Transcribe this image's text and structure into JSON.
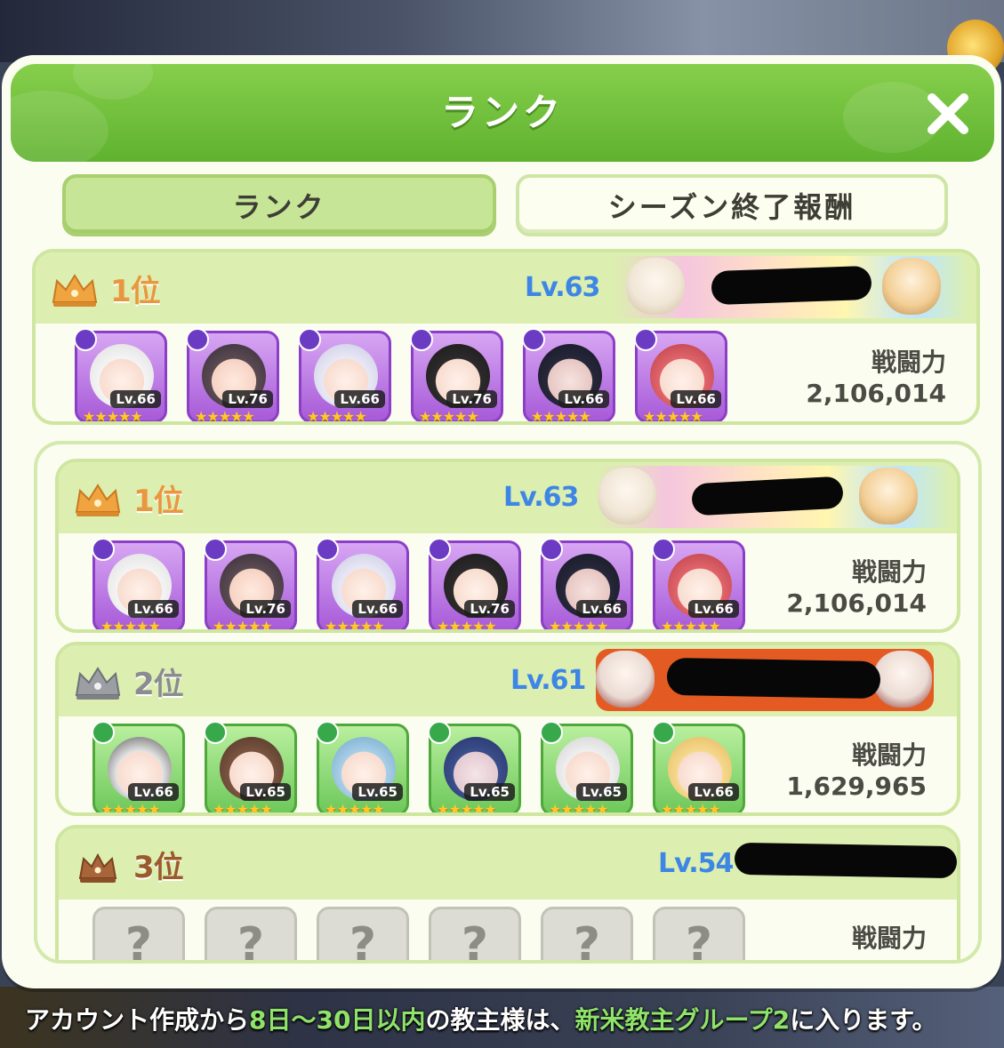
{
  "modal": {
    "title": "ランク",
    "close_icon": "close-icon"
  },
  "tabs": [
    {
      "label": "ランク",
      "active": true
    },
    {
      "label": "シーズン終了報酬",
      "active": false
    }
  ],
  "my_rank": {
    "rank": "1位",
    "level": "Lv.63",
    "power_label": "戦闘力",
    "power": "2,106,014",
    "units": [
      {
        "lv": "Lv.66",
        "stars": "★★★★★"
      },
      {
        "lv": "Lv.76",
        "stars": "★★★★★"
      },
      {
        "lv": "Lv.66",
        "stars": "★★★★★"
      },
      {
        "lv": "Lv.76",
        "stars": "★★★★★"
      },
      {
        "lv": "Lv.66",
        "stars": "★★★★★"
      },
      {
        "lv": "Lv.66",
        "stars": "★★★★★"
      }
    ]
  },
  "ranking": [
    {
      "rank": "1位",
      "level": "Lv.63",
      "power_label": "戦闘力",
      "power": "2,106,014",
      "units": [
        {
          "lv": "Lv.66",
          "stars": "★★★★★"
        },
        {
          "lv": "Lv.76",
          "stars": "★★★★★"
        },
        {
          "lv": "Lv.66",
          "stars": "★★★★★"
        },
        {
          "lv": "Lv.76",
          "stars": "★★★★★"
        },
        {
          "lv": "Lv.66",
          "stars": "★★★★★"
        },
        {
          "lv": "Lv.66",
          "stars": "★★★★★"
        }
      ]
    },
    {
      "rank": "2位",
      "level": "Lv.61",
      "power_label": "戦闘力",
      "power": "1,629,965",
      "units": [
        {
          "lv": "Lv.66",
          "stars": "★★★★★"
        },
        {
          "lv": "Lv.65",
          "stars": "★★★★★"
        },
        {
          "lv": "Lv.65",
          "stars": "★★★★★"
        },
        {
          "lv": "Lv.65",
          "stars": "★★★★★"
        },
        {
          "lv": "Lv.65",
          "stars": "★★★★★"
        },
        {
          "lv": "Lv.66",
          "stars": "★★★★★"
        }
      ]
    },
    {
      "rank": "3位",
      "level": "Lv.54",
      "power_label": "戦闘力",
      "units": [
        {
          "q": "?"
        },
        {
          "q": "?"
        },
        {
          "q": "?"
        },
        {
          "q": "?"
        },
        {
          "q": "?"
        },
        {
          "q": "?"
        }
      ]
    }
  ],
  "footer": {
    "part1": "アカウント作成から",
    "highlight1": "8日〜30日以内",
    "part2": "の教主様は、",
    "highlight2": "新米教主グループ2",
    "part3": "に入ります。"
  },
  "colors": {
    "header_green": "#6cbe38",
    "level_blue": "#3d86e6",
    "gold": "#e9973e",
    "unit_purple": "#a75ad8",
    "unit_green": "#6dc85a"
  }
}
